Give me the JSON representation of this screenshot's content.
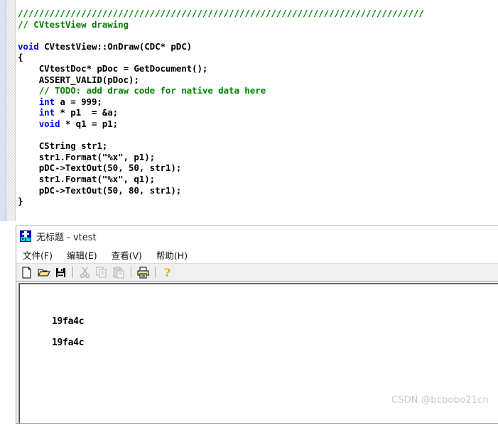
{
  "editor": {
    "name": "source-code-pane",
    "language": "cpp",
    "lines": [
      {
        "segments": [
          {
            "kind": "comment",
            "text": "/////////////////////////////////////////////////////////////////////////////"
          }
        ]
      },
      {
        "segments": [
          {
            "kind": "comment",
            "text": "// CVtestView drawing"
          }
        ]
      },
      {
        "segments": [
          {
            "kind": "plain",
            "text": ""
          }
        ]
      },
      {
        "segments": [
          {
            "kind": "kw",
            "text": "void"
          },
          {
            "kind": "plain",
            "text": " CVtestView::OnDraw(CDC* pDC)"
          }
        ]
      },
      {
        "segments": [
          {
            "kind": "plain",
            "text": "{"
          }
        ]
      },
      {
        "segments": [
          {
            "kind": "plain",
            "text": "    CVtestDoc* pDoc = GetDocument();"
          }
        ]
      },
      {
        "segments": [
          {
            "kind": "plain",
            "text": "    ASSERT_VALID(pDoc);"
          }
        ]
      },
      {
        "segments": [
          {
            "kind": "plain",
            "text": "    "
          },
          {
            "kind": "comment",
            "text": "// TODO: add draw code for native data here"
          }
        ]
      },
      {
        "segments": [
          {
            "kind": "plain",
            "text": "    "
          },
          {
            "kind": "kw",
            "text": "int"
          },
          {
            "kind": "plain",
            "text": " a = 999;"
          }
        ]
      },
      {
        "segments": [
          {
            "kind": "plain",
            "text": "    "
          },
          {
            "kind": "kw",
            "text": "int"
          },
          {
            "kind": "plain",
            "text": " * p1  = &a;"
          }
        ]
      },
      {
        "segments": [
          {
            "kind": "plain",
            "text": "    "
          },
          {
            "kind": "kw",
            "text": "void"
          },
          {
            "kind": "plain",
            "text": " * q1 = p1;"
          }
        ]
      },
      {
        "segments": [
          {
            "kind": "plain",
            "text": ""
          }
        ]
      },
      {
        "segments": [
          {
            "kind": "plain",
            "text": "    CString str1;"
          }
        ]
      },
      {
        "segments": [
          {
            "kind": "plain",
            "text": "    str1.Format(\"%x\", p1);"
          }
        ]
      },
      {
        "segments": [
          {
            "kind": "plain",
            "text": "    pDC->TextOut(50, 50, str1);"
          }
        ]
      },
      {
        "segments": [
          {
            "kind": "plain",
            "text": "    str1.Format(\"%x\", q1);"
          }
        ]
      },
      {
        "segments": [
          {
            "kind": "plain",
            "text": "    pDC->TextOut(50, 80, str1);"
          }
        ]
      },
      {
        "segments": [
          {
            "kind": "plain",
            "text": "}"
          }
        ]
      }
    ],
    "colors": {
      "comment": "#008000",
      "keyword": "#0000ff",
      "plain": "#000000",
      "background": "#ffffff",
      "selection_margin": "#d6e3f2"
    }
  },
  "app_window": {
    "title": "无标题 - vtest",
    "icon": "mfc-app-icon",
    "menubar": [
      {
        "label": "文件(F)",
        "name": "menu-file"
      },
      {
        "label": "编辑(E)",
        "name": "menu-edit"
      },
      {
        "label": "查看(V)",
        "name": "menu-view"
      },
      {
        "label": "帮助(H)",
        "name": "menu-help"
      }
    ],
    "toolbar": [
      {
        "icon": "new-document-icon",
        "name": "toolbar-new",
        "enabled": true
      },
      {
        "icon": "open-folder-icon",
        "name": "toolbar-open",
        "enabled": true
      },
      {
        "icon": "save-disk-icon",
        "name": "toolbar-save",
        "enabled": true
      },
      {
        "icon": "separator",
        "name": "toolbar-separator-1",
        "enabled": false
      },
      {
        "icon": "scissors-cut-icon",
        "name": "toolbar-cut",
        "enabled": false
      },
      {
        "icon": "copy-icon",
        "name": "toolbar-copy",
        "enabled": false
      },
      {
        "icon": "clipboard-paste-icon",
        "name": "toolbar-paste",
        "enabled": false
      },
      {
        "icon": "separator",
        "name": "toolbar-separator-2",
        "enabled": false
      },
      {
        "icon": "printer-icon",
        "name": "toolbar-print",
        "enabled": true
      },
      {
        "icon": "separator",
        "name": "toolbar-separator-3",
        "enabled": false
      },
      {
        "icon": "question-mark-about-icon",
        "name": "toolbar-about",
        "enabled": true
      }
    ],
    "client_output": {
      "line_1": "19fa4c",
      "line_2": "19fa4c"
    }
  },
  "watermark": {
    "text": "CSDN @bcbobo21cn"
  }
}
